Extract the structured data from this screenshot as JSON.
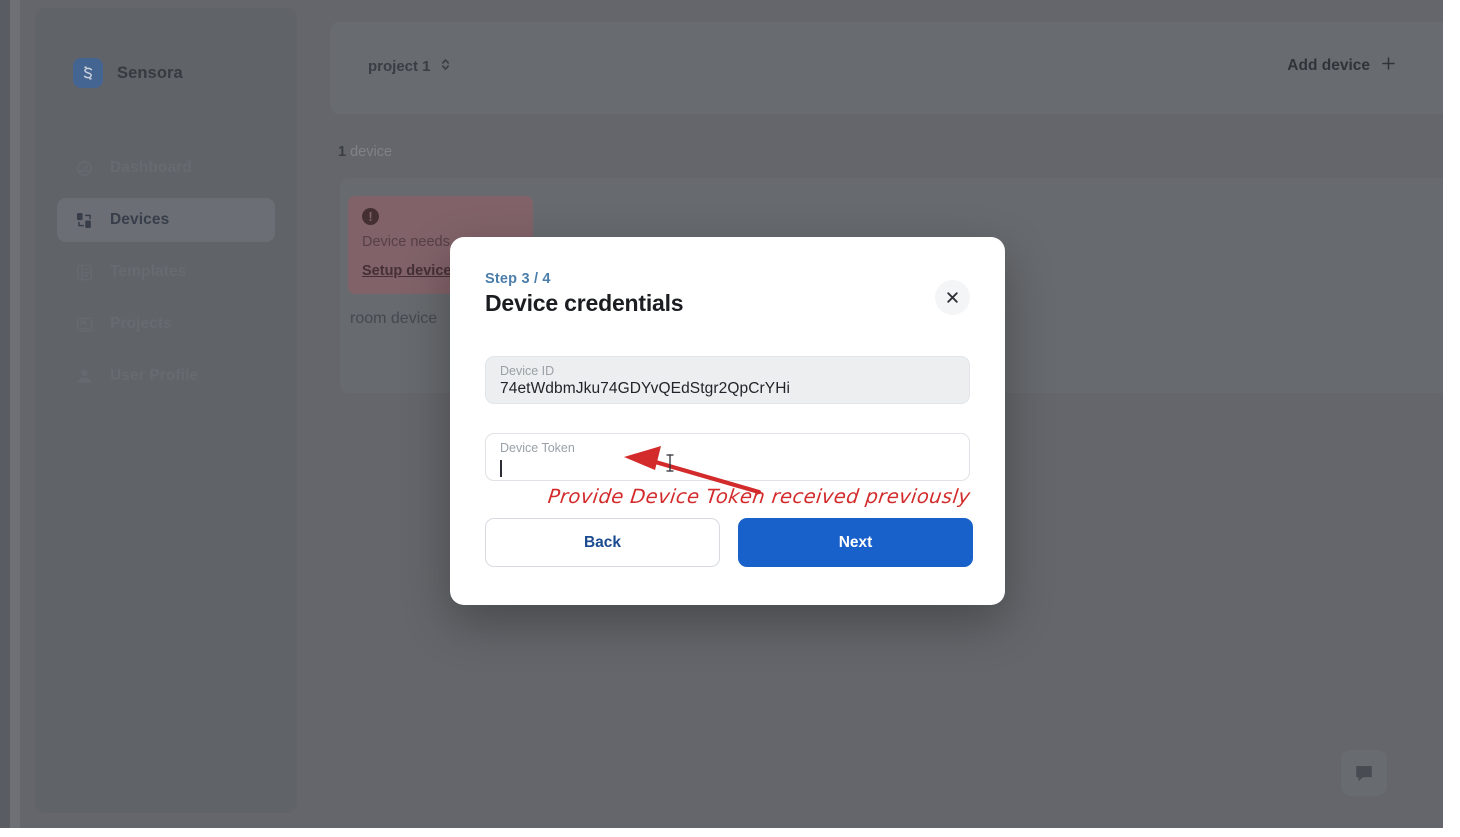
{
  "app": {
    "brand": "Sensora",
    "brand_icon": "sensora-logo-icon",
    "accent_blue": "#1860ca",
    "step_blue": "#4b7eaa",
    "annotation_red": "#d32b2b"
  },
  "sidebar": {
    "items": [
      {
        "label": "Dashboard",
        "icon": "dashboard-icon",
        "active": false
      },
      {
        "label": "Devices",
        "icon": "devices-icon",
        "active": true
      },
      {
        "label": "Templates",
        "icon": "templates-icon",
        "active": false
      },
      {
        "label": "Projects",
        "icon": "projects-icon",
        "active": false
      },
      {
        "label": "User Profile",
        "icon": "user-profile-icon",
        "active": false
      }
    ]
  },
  "topbar": {
    "project_selected": "project 1",
    "project_selector_icon": "chevron-up-down-icon",
    "add_device_label": "Add device",
    "add_device_icon": "plus-icon"
  },
  "main": {
    "device_count_number": "1",
    "device_count_label": "device",
    "alert": {
      "icon": "exclamation-circle-icon",
      "message": "Device needs",
      "link_label": "Setup device"
    },
    "device_name": "room device",
    "chat_icon": "chat-bubble-icon"
  },
  "modal": {
    "step": "Step 3 / 4",
    "title": "Device credentials",
    "close_icon": "close-icon",
    "fields": [
      {
        "label": "Device ID",
        "value": "74etWdbmJku74GDYvQEdStgr2QpCrYHi",
        "placeholder": "Device ID",
        "readonly": true
      },
      {
        "label": "Device Token",
        "value": "",
        "placeholder": "Device Token",
        "readonly": false
      }
    ],
    "back_label": "Back",
    "next_label": "Next"
  },
  "annotation": {
    "text": "Provide Device Token received previously",
    "arrow_icon": "arrow-pointer-icon",
    "mouse_icon": "i-beam-cursor-icon"
  }
}
